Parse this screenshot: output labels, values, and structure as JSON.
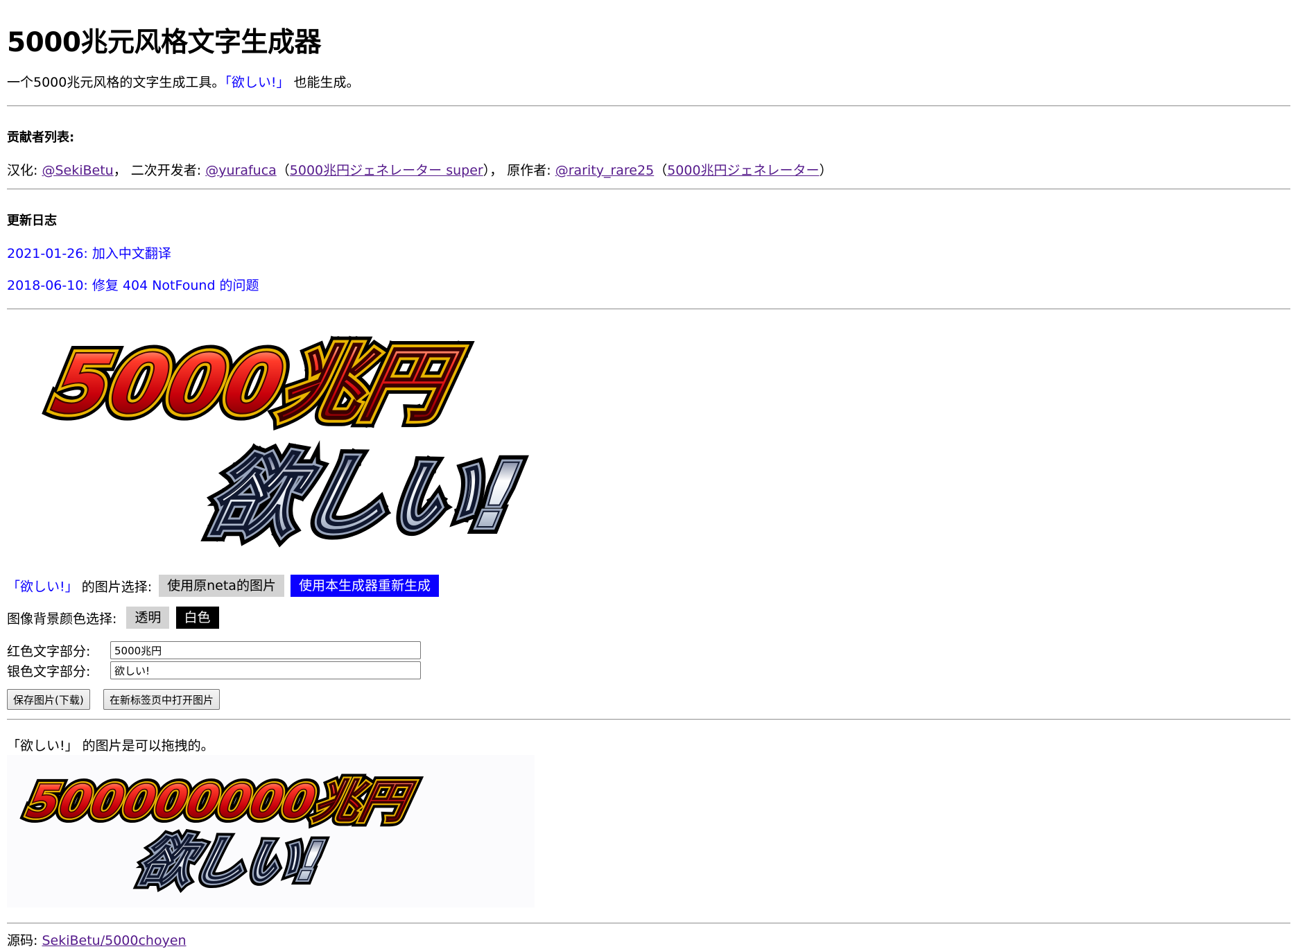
{
  "page": {
    "title": "5000兆元风格文字生成器",
    "intro_prefix": "一个5000兆元风格的文字生成工具。",
    "intro_quote": "「欲しい!」",
    "intro_suffix": "也能生成。"
  },
  "contributors": {
    "heading": "贡献者列表:",
    "localization_label": "汉化:",
    "localization_link": "@SekiBetu",
    "secondary_dev_label": "二次开发者:",
    "secondary_dev_link": "@yurafuca",
    "secondary_dev_project": "5000兆円ジェネレーター super",
    "original_author_label": "原作者:",
    "original_author_link": "@rarity_rare25",
    "original_project": "5000兆円ジェネレーター"
  },
  "changelog": {
    "heading": "更新日志",
    "entries": [
      "2021-01-26: 加入中文翻译",
      "2018-06-10: 修复 404 NotFound 的问题"
    ]
  },
  "preview_image": {
    "red_text": "5000兆円",
    "silver_text": "欲しい!"
  },
  "options": {
    "hoshii_quote": "「欲しい!」",
    "hoshii_label": "的图片选择:",
    "hoshii_choices": [
      "使用原neta的图片",
      "使用本生成器重新生成"
    ],
    "bg_label": "图像背景颜色选择:",
    "bg_choices": [
      "透明",
      "白色"
    ]
  },
  "form": {
    "red_label": "红色文字部分:",
    "red_value": "5000兆円",
    "silver_label": "银色文字部分:",
    "silver_value": "欲しい!",
    "save_button": "保存图片(下载)",
    "open_button": "在新标签页中打开图片"
  },
  "drag_section": {
    "note": "「欲しい!」 的图片是可以拖拽的。",
    "red_text": "500000000兆円",
    "silver_text": "欲しい!"
  },
  "footer": {
    "source_label": "源码:",
    "source_link": "SekiBetu/5000choyen"
  },
  "colors": {
    "accent_blue": "#0b00ff",
    "visited_link": "#551a8b",
    "selected_black": "#000000",
    "unselected_grey": "#d3d3d3",
    "red_text_fill": "#c8000a",
    "gold_outline": "#e8b400",
    "silver_text_fill": "#dfe6ef"
  }
}
